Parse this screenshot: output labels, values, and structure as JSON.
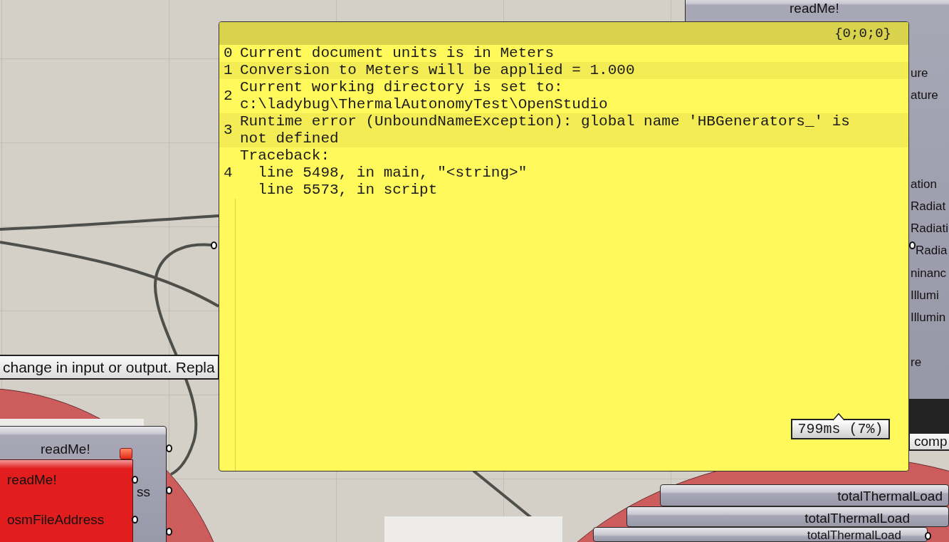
{
  "canvas": {
    "top_component": {
      "title": "readMe!",
      "outputs": [
        "ure",
        "ature",
        "ation",
        "Radiat",
        "Radiati",
        "Radia",
        "ninanc",
        "Illumi",
        "Illumin",
        "re"
      ]
    },
    "status_tip": "comp",
    "left_tip": "change in input or output. Repla",
    "left_component": {
      "title": "readMe!",
      "outputs": [
        "ss"
      ]
    },
    "error_balloon": {
      "items": [
        "readMe!",
        "osmFileAddress"
      ]
    },
    "stacked_components": [
      {
        "title": "totalThermalLoad"
      },
      {
        "title": "totalThermalLoad"
      },
      {
        "title": "totalThermalLoad"
      }
    ]
  },
  "panel": {
    "path": "{0;0;0}",
    "entries": [
      {
        "index": "0",
        "lines": [
          "Current document units is in Meters"
        ]
      },
      {
        "index": "1",
        "lines": [
          "Conversion to Meters will be applied = 1.000"
        ]
      },
      {
        "index": "2",
        "lines": [
          "Current working directory is set to:",
          "c:\\ladybug\\ThermalAutonomyTest\\OpenStudio"
        ]
      },
      {
        "index": "3",
        "lines": [
          "Runtime error (UnboundNameException): global name 'HBGenerators_' is",
          "not defined"
        ]
      },
      {
        "index": "4",
        "lines": [
          "Traceback:",
          "  line 5498, in main, \"<string>\"",
          "  line 5573, in script"
        ]
      }
    ],
    "timing": "799ms (7%)"
  }
}
